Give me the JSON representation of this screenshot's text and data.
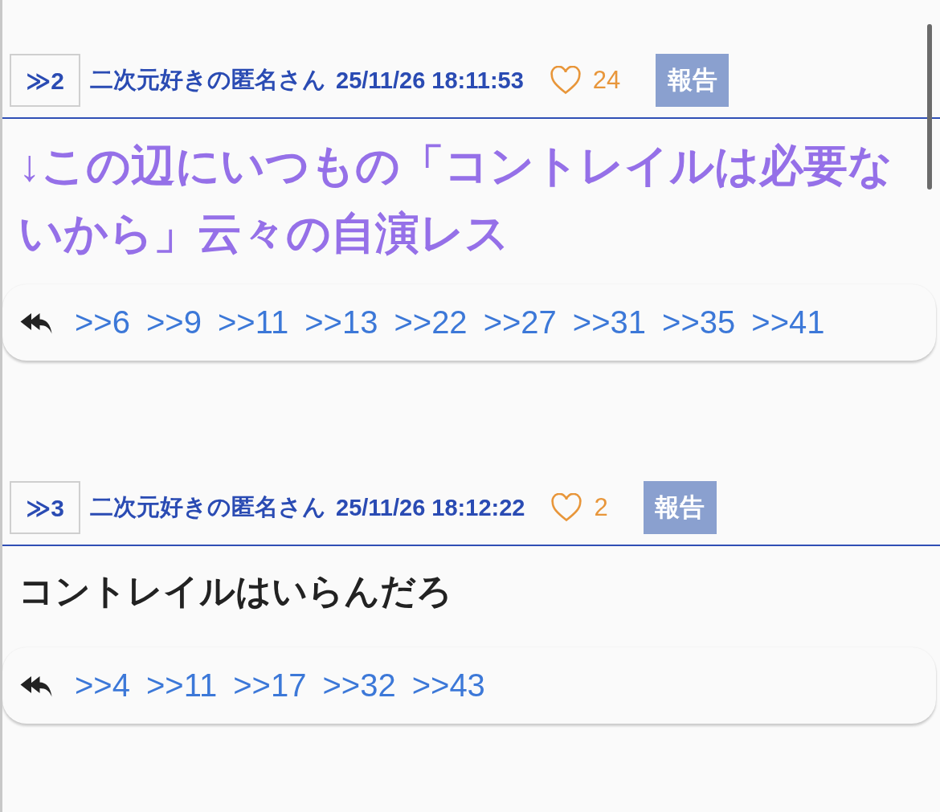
{
  "posts": [
    {
      "number": "≫2",
      "author": "二次元好きの匿名さん",
      "datetime": "25/11/26 18:11:53",
      "likes": "24",
      "report": "報告",
      "kind": "highlight",
      "body": "↓この辺にいつもの「コントレイルは必要ないから」云々の自演レス",
      "replies": [
        ">>6",
        ">>9",
        ">>11",
        ">>13",
        ">>22",
        ">>27",
        ">>31",
        ">>35",
        ">>41"
      ]
    },
    {
      "number": "≫3",
      "author": "二次元好きの匿名さん",
      "datetime": "25/11/26 18:12:22",
      "likes": "2",
      "report": "報告",
      "kind": "plain",
      "body": "コントレイルはいらんだろ",
      "replies": [
        ">>4",
        ">>11",
        ">>17",
        ">>32",
        ">>43"
      ]
    }
  ]
}
